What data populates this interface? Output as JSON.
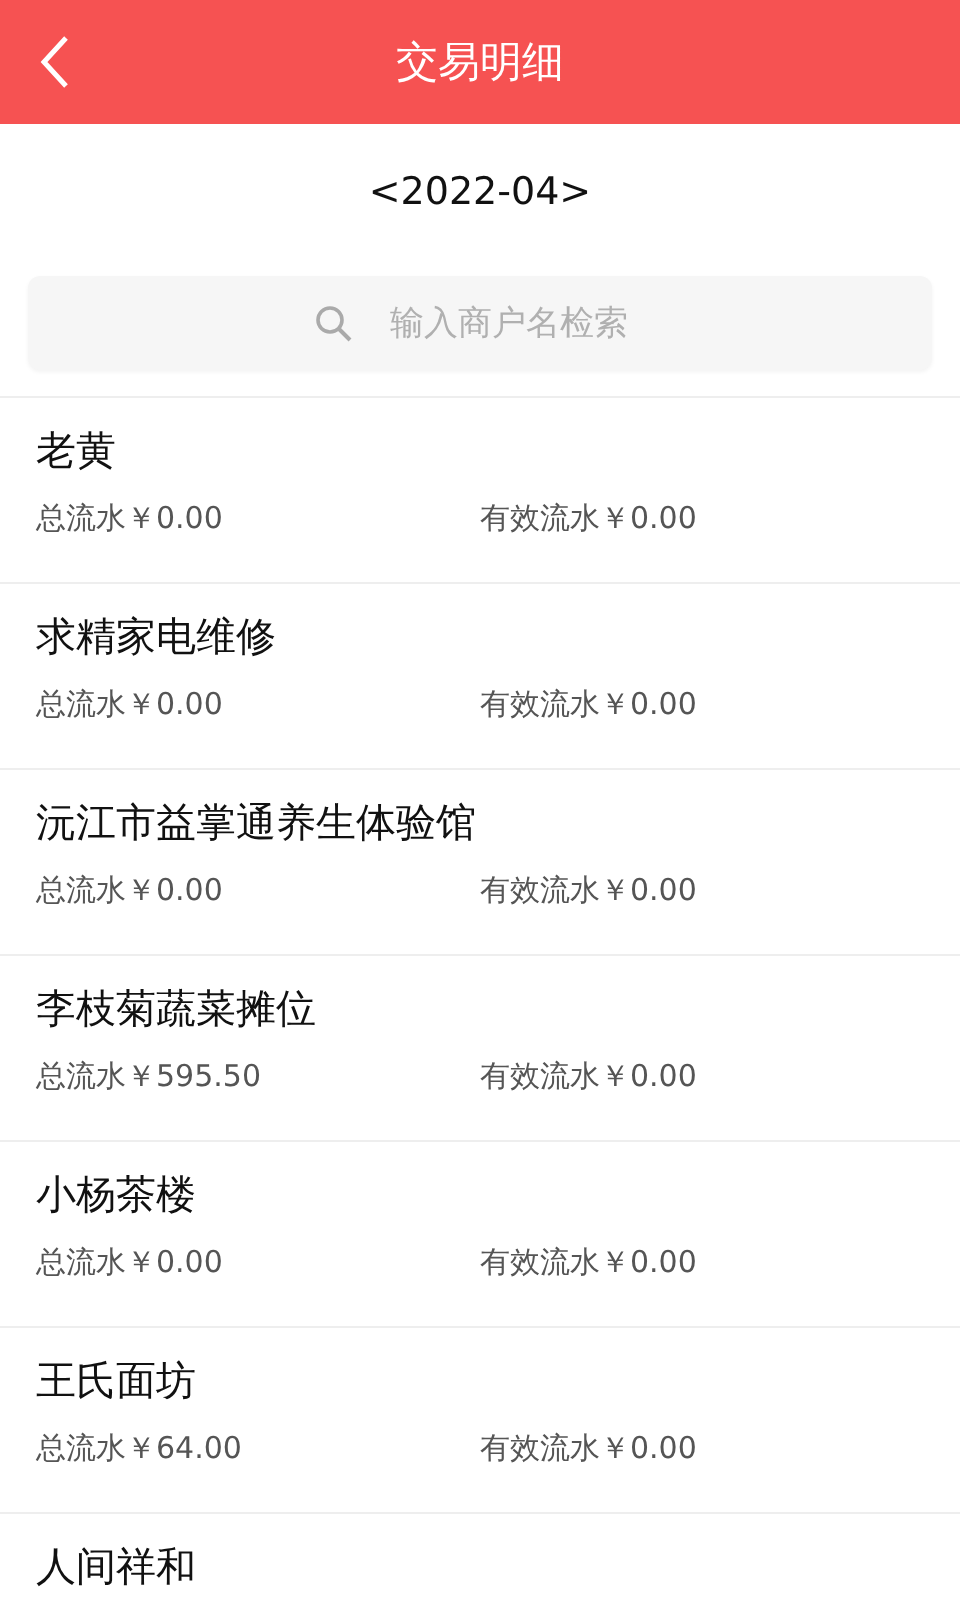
{
  "header": {
    "title": "交易明细"
  },
  "period": "<2022-04>",
  "search": {
    "placeholder": "输入商户名检索"
  },
  "merchants": [
    {
      "name": "老黄",
      "total": "总流水￥0.00",
      "valid": "有效流水￥0.00"
    },
    {
      "name": "求精家电维修",
      "total": "总流水￥0.00",
      "valid": "有效流水￥0.00"
    },
    {
      "name": "沅江市益掌通养生体验馆",
      "total": "总流水￥0.00",
      "valid": "有效流水￥0.00"
    },
    {
      "name": "李枝菊蔬菜摊位",
      "total": "总流水￥595.50",
      "valid": "有效流水￥0.00"
    },
    {
      "name": "小杨茶楼",
      "total": "总流水￥0.00",
      "valid": "有效流水￥0.00"
    },
    {
      "name": "王氏面坊",
      "total": "总流水￥64.00",
      "valid": "有效流水￥0.00"
    },
    {
      "name": "人间祥和"
    }
  ]
}
